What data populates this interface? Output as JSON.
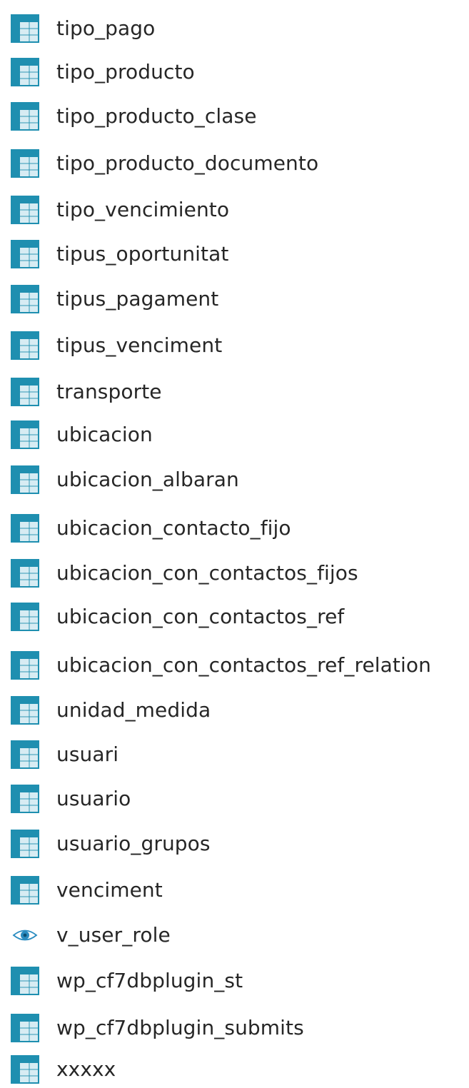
{
  "tree": {
    "items": [
      {
        "label": "tipo_pago",
        "icon": "table-icon"
      },
      {
        "label": "tipo_producto",
        "icon": "table-icon"
      },
      {
        "label": "tipo_producto_clase",
        "icon": "table-icon"
      },
      {
        "label": "tipo_producto_documento",
        "icon": "table-icon"
      },
      {
        "label": "tipo_vencimiento",
        "icon": "table-icon"
      },
      {
        "label": "tipus_oportunitat",
        "icon": "table-icon"
      },
      {
        "label": "tipus_pagament",
        "icon": "table-icon"
      },
      {
        "label": "tipus_venciment",
        "icon": "table-icon"
      },
      {
        "label": "transporte",
        "icon": "table-icon"
      },
      {
        "label": "ubicacion",
        "icon": "table-icon"
      },
      {
        "label": "ubicacion_albaran",
        "icon": "table-icon"
      },
      {
        "label": "ubicacion_contacto_fijo",
        "icon": "table-icon"
      },
      {
        "label": "ubicacion_con_contactos_fijos",
        "icon": "table-icon"
      },
      {
        "label": "ubicacion_con_contactos_ref",
        "icon": "table-icon"
      },
      {
        "label": "ubicacion_con_contactos_ref_relation",
        "icon": "table-icon"
      },
      {
        "label": "unidad_medida",
        "icon": "table-icon"
      },
      {
        "label": "usuari",
        "icon": "table-icon"
      },
      {
        "label": "usuario",
        "icon": "table-icon"
      },
      {
        "label": "usuario_grupos",
        "icon": "table-icon"
      },
      {
        "label": "venciment",
        "icon": "table-icon"
      },
      {
        "label": "v_user_role",
        "icon": "view-icon"
      },
      {
        "label": "wp_cf7dbplugin_st",
        "icon": "table-icon"
      },
      {
        "label": "wp_cf7dbplugin_submits",
        "icon": "table-icon"
      },
      {
        "label": "xxxxx",
        "icon": "table-icon"
      }
    ]
  },
  "colors": {
    "table_header": "#1f8fb0",
    "table_grid": "#1f8fb0",
    "table_cell": "#d7ecf3",
    "view_eye": "#2a8cc0",
    "text": "#262626"
  }
}
